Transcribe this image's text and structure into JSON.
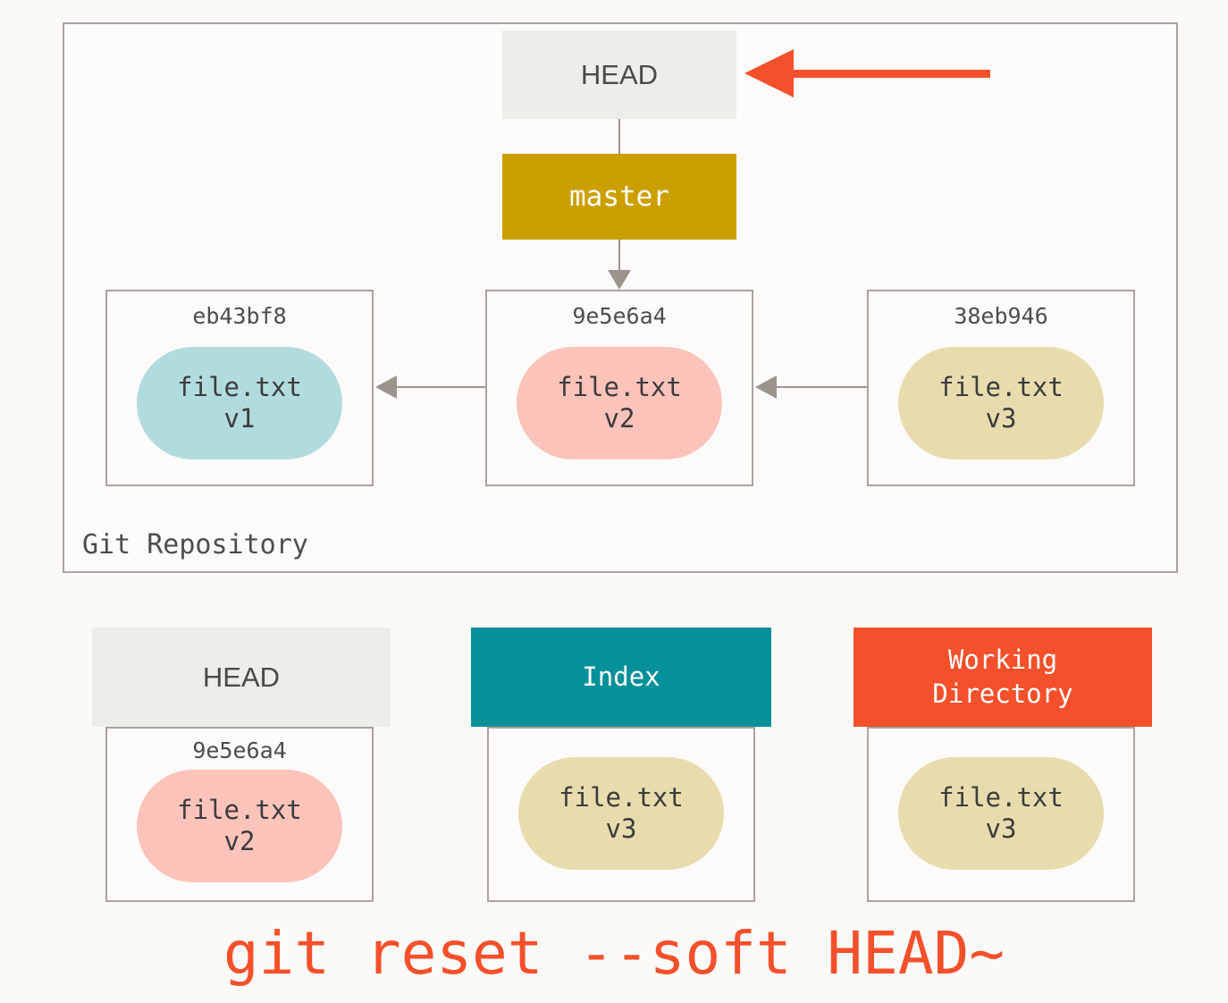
{
  "repository": {
    "label": "Git Repository",
    "head_pointer": {
      "label": "HEAD",
      "highlight_arrow": "red-left-arrow"
    },
    "branch": {
      "label": "master"
    },
    "commits": [
      {
        "hash": "eb43bf8",
        "file_name": "file.txt",
        "file_version": "v1",
        "blob_color": "#b2dbdd"
      },
      {
        "hash": "9e5e6a4",
        "file_name": "file.txt",
        "file_version": "v2",
        "blob_color": "#fcc3ba"
      },
      {
        "hash": "38eb946",
        "file_name": "file.txt",
        "file_version": "v3",
        "blob_color": "#e8dcae"
      }
    ]
  },
  "areas": [
    {
      "title": "HEAD",
      "title_line2": "",
      "hash": "9e5e6a4",
      "file_name": "file.txt",
      "file_version": "v2",
      "header_color": "#eceee7",
      "blob_color": "#fcc3ba"
    },
    {
      "title": "Index",
      "title_line2": "",
      "hash": "",
      "file_name": "file.txt",
      "file_version": "v3",
      "header_color": "#069099",
      "blob_color": "#e8dcae"
    },
    {
      "title": "Working",
      "title_line2": "Directory",
      "hash": "",
      "file_name": "file.txt",
      "file_version": "v3",
      "header_color": "#f4502b",
      "blob_color": "#e8dcae"
    }
  ],
  "caption": "git reset --soft HEAD~",
  "colors": {
    "accent_red": "#f4502b",
    "branch_gold": "#cc9f00",
    "index_teal": "#069099",
    "border_gray": "#a9a49c",
    "connector_gray": "#9a948c",
    "page_background": "#fbfaf7"
  }
}
